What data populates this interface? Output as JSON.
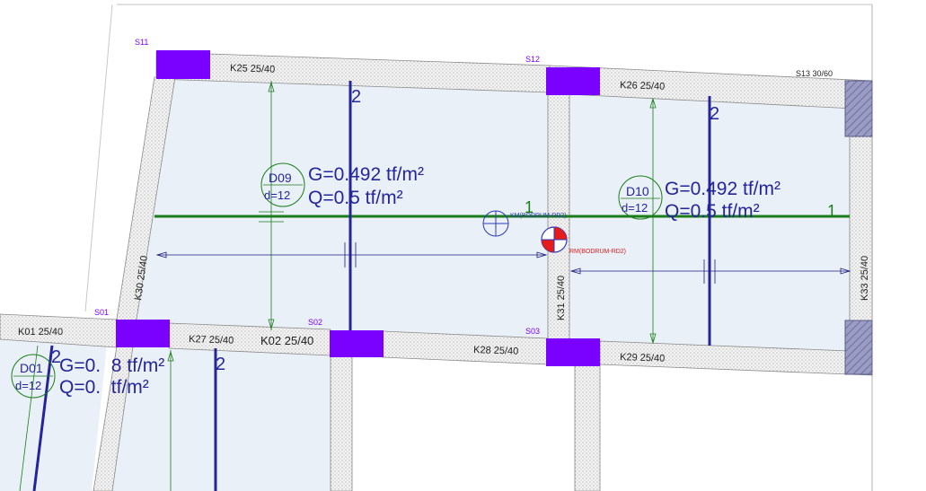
{
  "colors": {
    "slab_fill": "#e9f0f7",
    "column": "#7a00ff",
    "column_edge": "#7b7fa6",
    "beam_hatch": "#c8c8c8",
    "rebar_line": "#25259a",
    "load_line": "#1a7d1a",
    "dim_line": "#1c1c80",
    "axis_label": "#7a00ff",
    "mass_center": "#ff2a2a",
    "stiffness_center": "#2b3bb8"
  },
  "columns": {
    "s11": "S11",
    "s12": "S12",
    "s13": "S13 30/60",
    "s01": "S01",
    "s02": "S02",
    "s03": "S03"
  },
  "beams": {
    "k25": "K25 25/40",
    "k26": "K26 25/40",
    "k27": "K27 25/40",
    "k02": "K02 25/40",
    "k28": "K28 25/40",
    "k29": "K29 25/40",
    "k01": "K01 25/40",
    "k30": "K30 25/40",
    "k31": "K31 25/40",
    "k33": "K33 25/40"
  },
  "slabs": {
    "d09": {
      "name": "D09",
      "thickness": "d=12",
      "g_load": "G=0.492 tf/m²",
      "q_load": "Q=0.5 tf/m²",
      "dir1": "1",
      "dir2": "2"
    },
    "d10": {
      "name": "D10",
      "thickness": "d=12",
      "g_load": "G=0.492 tf/m²",
      "q_load": "Q=0.5 tf/m²",
      "dir1": "1",
      "dir2": "2"
    },
    "d01": {
      "name": "D01",
      "thickness": "d=12",
      "g_load": "G=0.  8 tf/m²",
      "q_load": "Q=0.  tf/m²",
      "dir2a": "2",
      "dir2b": "2"
    }
  },
  "markers": {
    "stiffness_center": "KM(BODRUM-RD2)",
    "mass_center": "RM(BODRUM-RD2)"
  }
}
